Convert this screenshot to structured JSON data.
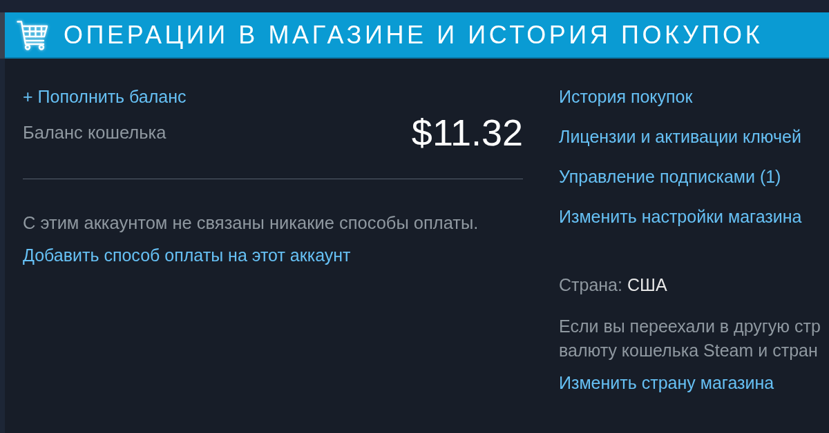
{
  "header": {
    "title": "ОПЕРАЦИИ В МАГАЗИНЕ И ИСТОРИЯ ПОКУПОК"
  },
  "wallet": {
    "add_funds_link": "+ Пополнить баланс",
    "label": "Баланс кошелька",
    "balance": "$11.32"
  },
  "payment": {
    "message": "С этим аккаунтом не связаны никакие способы оплаты.",
    "add_method_link": "Добавить способ оплаты на этот аккаунт"
  },
  "links": [
    "История покупок",
    "Лицензии и активации ключей",
    "Управление подписками (1)",
    "Изменить настройки магазина"
  ],
  "country": {
    "label": "Страна:",
    "value": "США",
    "note_lines": [
      "Если вы переехали в другую стр",
      "валюту кошелька Steam и стран"
    ],
    "change_link": "Изменить страну магазина"
  }
}
